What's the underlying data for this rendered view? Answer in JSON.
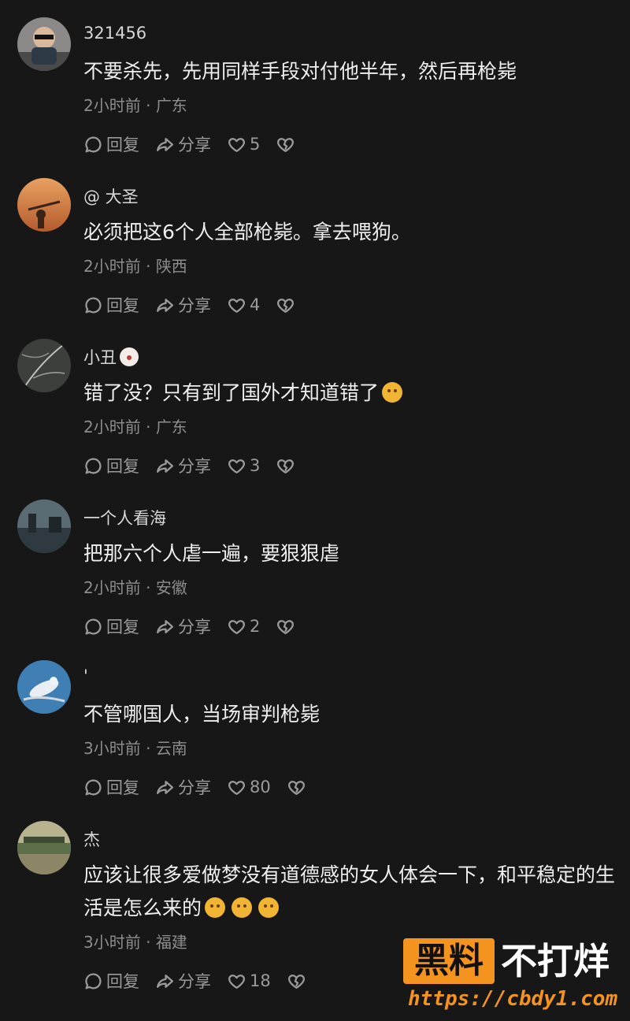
{
  "actions": {
    "reply_label": "回复",
    "share_label": "分享"
  },
  "comments": [
    {
      "username": "321456",
      "text": "不要杀先，先用同样手段对付他半年，然后再枪毙",
      "time": "2小时前",
      "separator": "·",
      "location": "广东",
      "likes": "5"
    },
    {
      "username": "@ 大圣",
      "text": "必须把这6个人全部枪毙。拿去喂狗。",
      "time": "2小时前",
      "separator": "·",
      "location": "陕西",
      "likes": "4"
    },
    {
      "username": "小丑",
      "text": "错了没？只有到了国外才知道错了",
      "time": "2小时前",
      "separator": "·",
      "location": "广东",
      "likes": "3"
    },
    {
      "username": "一个人看海",
      "text": "把那六个人虐一遍，要狠狠虐",
      "time": "2小时前",
      "separator": "·",
      "location": "安徽",
      "likes": "2"
    },
    {
      "username": "'",
      "text": "不管哪国人，当场审判枪毙",
      "time": "3小时前",
      "separator": "·",
      "location": "云南",
      "likes": "80"
    },
    {
      "username": "杰",
      "text": "应该让很多爱做梦没有道德感的女人体会一下，和平稳定的生活是怎么来的",
      "time": "3小时前",
      "separator": "·",
      "location": "福建",
      "likes": "18"
    }
  ],
  "watermark": {
    "brand_box": "黑料",
    "brand_text": "不打烊",
    "url": "https://cbdy1.com"
  },
  "colors": {
    "background": "#171717",
    "text": "#efefef",
    "muted": "#8d8d8d",
    "accent": "#f4931d"
  }
}
